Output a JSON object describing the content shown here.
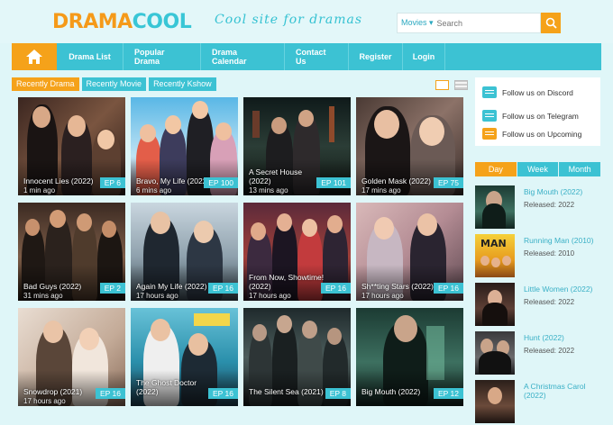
{
  "header": {
    "logo_part1": "DRAMA",
    "logo_part2": "COOL",
    "tagline": "Cool site for dramas",
    "search_select": "Movies ▾",
    "search_placeholder": "Search"
  },
  "nav": {
    "items": [
      "Drama List",
      "Popular Drama",
      "Drama Calendar",
      "Contact Us",
      "Register",
      "Login"
    ]
  },
  "tabs": [
    "Recently Drama",
    "Recently Movie",
    "Recently Kshow"
  ],
  "cards": [
    {
      "title": "Innocent Lies (2022)",
      "ago": "1 min ago",
      "ep": "EP 6"
    },
    {
      "title": "Bravo, My Life (2022)",
      "ago": "6 mins ago",
      "ep": "EP 100"
    },
    {
      "title": "A Secret House (2022)",
      "ago": "13 mins ago",
      "ep": "EP 101"
    },
    {
      "title": "Golden Mask (2022)",
      "ago": "17 mins ago",
      "ep": "EP 75"
    },
    {
      "title": "Bad Guys (2022)",
      "ago": "31 mins ago",
      "ep": "EP 2"
    },
    {
      "title": "Again My Life (2022)",
      "ago": "17 hours ago",
      "ep": "EP 16"
    },
    {
      "title": "From Now, Showtime! (2022)",
      "ago": "17 hours ago",
      "ep": "EP 16"
    },
    {
      "title": "Sh**ting Stars (2022)",
      "ago": "17 hours ago",
      "ep": "EP 16"
    },
    {
      "title": "Snowdrop (2021)",
      "ago": "17 hours ago",
      "ep": "EP 16"
    },
    {
      "title": "The Ghost Doctor (2022)",
      "ago": "",
      "ep": "EP 16"
    },
    {
      "title": "The Silent Sea (2021)",
      "ago": "",
      "ep": "EP 8"
    },
    {
      "title": "Big Mouth (2022)",
      "ago": "",
      "ep": "EP 12"
    }
  ],
  "follow": [
    "Follow us on Discord",
    "Follow us on Telegram",
    "Follow us on Upcoming"
  ],
  "schedule_tabs": [
    "Day",
    "Week",
    "Month"
  ],
  "recent_list": [
    {
      "title": "Big Mouth (2022)",
      "released": "Released: 2022"
    },
    {
      "title": "Running Man (2010)",
      "released": "Released: 2010"
    },
    {
      "title": "Little Women (2022)",
      "released": "Released: 2022"
    },
    {
      "title": "Hunt (2022)",
      "released": "Released: 2022"
    },
    {
      "title": "A Christmas Carol (2022)",
      "released": ""
    }
  ],
  "colors": {
    "accent": "#3cc2d3",
    "orange": "#f5a21a",
    "bg": "#dff6f8"
  }
}
